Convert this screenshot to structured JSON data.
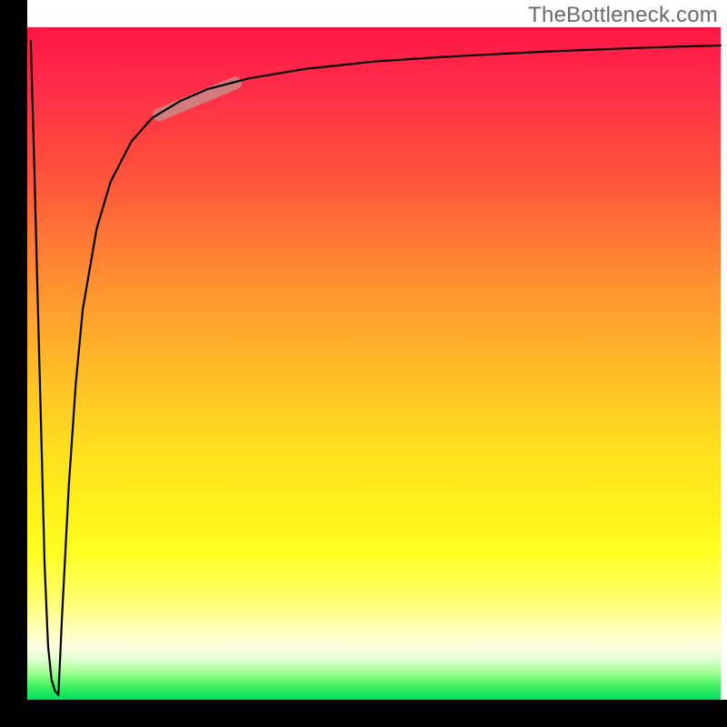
{
  "watermark": "TheBottleneck.com",
  "colors": {
    "axis": "#000000",
    "curve": "#000000",
    "highlight": "#c98b8b",
    "gradient_top": "#ff1744",
    "gradient_mid": "#ffe21e",
    "gradient_bottom": "#00e060"
  },
  "chart_data": {
    "type": "line",
    "title": "",
    "xlabel": "",
    "ylabel": "",
    "xlim": [
      0,
      100
    ],
    "ylim": [
      0,
      100
    ],
    "grid": false,
    "legend": false,
    "series": [
      {
        "name": "left-spike",
        "x": [
          0.5,
          1.0,
          1.5,
          2.0,
          2.5,
          3.0,
          3.5,
          4.0,
          4.5
        ],
        "values": [
          98,
          80,
          60,
          40,
          20,
          8,
          3,
          1.3,
          0.7
        ]
      },
      {
        "name": "main-curve",
        "x": [
          4.5,
          5,
          6,
          7,
          8,
          10,
          12,
          15,
          18,
          22,
          26,
          32,
          40,
          50,
          60,
          75,
          90,
          100
        ],
        "values": [
          0.7,
          12,
          32,
          47,
          58,
          70,
          77,
          83,
          86.5,
          89,
          90.8,
          92.4,
          93.8,
          94.9,
          95.6,
          96.4,
          97.0,
          97.3
        ]
      }
    ],
    "highlight_segment": {
      "series": "main-curve",
      "x_range": [
        19,
        30
      ],
      "y_range": [
        87,
        91.7
      ]
    },
    "background": {
      "type": "vertical-gradient",
      "stops": [
        {
          "pos": 0.0,
          "color": "#ff1744"
        },
        {
          "pos": 0.5,
          "color": "#ffb22a"
        },
        {
          "pos": 0.78,
          "color": "#ffff22"
        },
        {
          "pos": 0.92,
          "color": "#fdffe0"
        },
        {
          "pos": 1.0,
          "color": "#00e060"
        }
      ]
    }
  }
}
